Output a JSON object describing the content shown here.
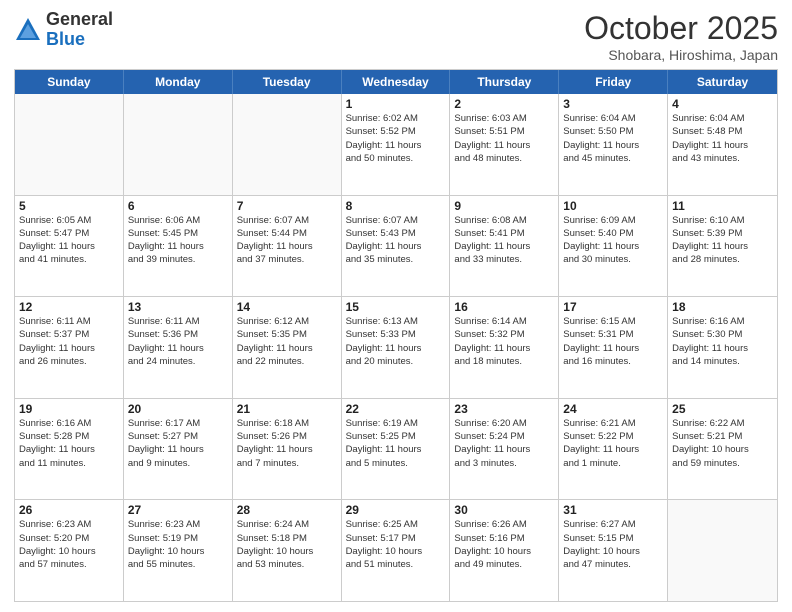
{
  "header": {
    "logo_general": "General",
    "logo_blue": "Blue",
    "month": "October 2025",
    "location": "Shobara, Hiroshima, Japan"
  },
  "weekdays": [
    "Sunday",
    "Monday",
    "Tuesday",
    "Wednesday",
    "Thursday",
    "Friday",
    "Saturday"
  ],
  "weeks": [
    [
      {
        "day": "",
        "info": ""
      },
      {
        "day": "",
        "info": ""
      },
      {
        "day": "",
        "info": ""
      },
      {
        "day": "1",
        "info": "Sunrise: 6:02 AM\nSunset: 5:52 PM\nDaylight: 11 hours\nand 50 minutes."
      },
      {
        "day": "2",
        "info": "Sunrise: 6:03 AM\nSunset: 5:51 PM\nDaylight: 11 hours\nand 48 minutes."
      },
      {
        "day": "3",
        "info": "Sunrise: 6:04 AM\nSunset: 5:50 PM\nDaylight: 11 hours\nand 45 minutes."
      },
      {
        "day": "4",
        "info": "Sunrise: 6:04 AM\nSunset: 5:48 PM\nDaylight: 11 hours\nand 43 minutes."
      }
    ],
    [
      {
        "day": "5",
        "info": "Sunrise: 6:05 AM\nSunset: 5:47 PM\nDaylight: 11 hours\nand 41 minutes."
      },
      {
        "day": "6",
        "info": "Sunrise: 6:06 AM\nSunset: 5:45 PM\nDaylight: 11 hours\nand 39 minutes."
      },
      {
        "day": "7",
        "info": "Sunrise: 6:07 AM\nSunset: 5:44 PM\nDaylight: 11 hours\nand 37 minutes."
      },
      {
        "day": "8",
        "info": "Sunrise: 6:07 AM\nSunset: 5:43 PM\nDaylight: 11 hours\nand 35 minutes."
      },
      {
        "day": "9",
        "info": "Sunrise: 6:08 AM\nSunset: 5:41 PM\nDaylight: 11 hours\nand 33 minutes."
      },
      {
        "day": "10",
        "info": "Sunrise: 6:09 AM\nSunset: 5:40 PM\nDaylight: 11 hours\nand 30 minutes."
      },
      {
        "day": "11",
        "info": "Sunrise: 6:10 AM\nSunset: 5:39 PM\nDaylight: 11 hours\nand 28 minutes."
      }
    ],
    [
      {
        "day": "12",
        "info": "Sunrise: 6:11 AM\nSunset: 5:37 PM\nDaylight: 11 hours\nand 26 minutes."
      },
      {
        "day": "13",
        "info": "Sunrise: 6:11 AM\nSunset: 5:36 PM\nDaylight: 11 hours\nand 24 minutes."
      },
      {
        "day": "14",
        "info": "Sunrise: 6:12 AM\nSunset: 5:35 PM\nDaylight: 11 hours\nand 22 minutes."
      },
      {
        "day": "15",
        "info": "Sunrise: 6:13 AM\nSunset: 5:33 PM\nDaylight: 11 hours\nand 20 minutes."
      },
      {
        "day": "16",
        "info": "Sunrise: 6:14 AM\nSunset: 5:32 PM\nDaylight: 11 hours\nand 18 minutes."
      },
      {
        "day": "17",
        "info": "Sunrise: 6:15 AM\nSunset: 5:31 PM\nDaylight: 11 hours\nand 16 minutes."
      },
      {
        "day": "18",
        "info": "Sunrise: 6:16 AM\nSunset: 5:30 PM\nDaylight: 11 hours\nand 14 minutes."
      }
    ],
    [
      {
        "day": "19",
        "info": "Sunrise: 6:16 AM\nSunset: 5:28 PM\nDaylight: 11 hours\nand 11 minutes."
      },
      {
        "day": "20",
        "info": "Sunrise: 6:17 AM\nSunset: 5:27 PM\nDaylight: 11 hours\nand 9 minutes."
      },
      {
        "day": "21",
        "info": "Sunrise: 6:18 AM\nSunset: 5:26 PM\nDaylight: 11 hours\nand 7 minutes."
      },
      {
        "day": "22",
        "info": "Sunrise: 6:19 AM\nSunset: 5:25 PM\nDaylight: 11 hours\nand 5 minutes."
      },
      {
        "day": "23",
        "info": "Sunrise: 6:20 AM\nSunset: 5:24 PM\nDaylight: 11 hours\nand 3 minutes."
      },
      {
        "day": "24",
        "info": "Sunrise: 6:21 AM\nSunset: 5:22 PM\nDaylight: 11 hours\nand 1 minute."
      },
      {
        "day": "25",
        "info": "Sunrise: 6:22 AM\nSunset: 5:21 PM\nDaylight: 10 hours\nand 59 minutes."
      }
    ],
    [
      {
        "day": "26",
        "info": "Sunrise: 6:23 AM\nSunset: 5:20 PM\nDaylight: 10 hours\nand 57 minutes."
      },
      {
        "day": "27",
        "info": "Sunrise: 6:23 AM\nSunset: 5:19 PM\nDaylight: 10 hours\nand 55 minutes."
      },
      {
        "day": "28",
        "info": "Sunrise: 6:24 AM\nSunset: 5:18 PM\nDaylight: 10 hours\nand 53 minutes."
      },
      {
        "day": "29",
        "info": "Sunrise: 6:25 AM\nSunset: 5:17 PM\nDaylight: 10 hours\nand 51 minutes."
      },
      {
        "day": "30",
        "info": "Sunrise: 6:26 AM\nSunset: 5:16 PM\nDaylight: 10 hours\nand 49 minutes."
      },
      {
        "day": "31",
        "info": "Sunrise: 6:27 AM\nSunset: 5:15 PM\nDaylight: 10 hours\nand 47 minutes."
      },
      {
        "day": "",
        "info": ""
      }
    ]
  ]
}
